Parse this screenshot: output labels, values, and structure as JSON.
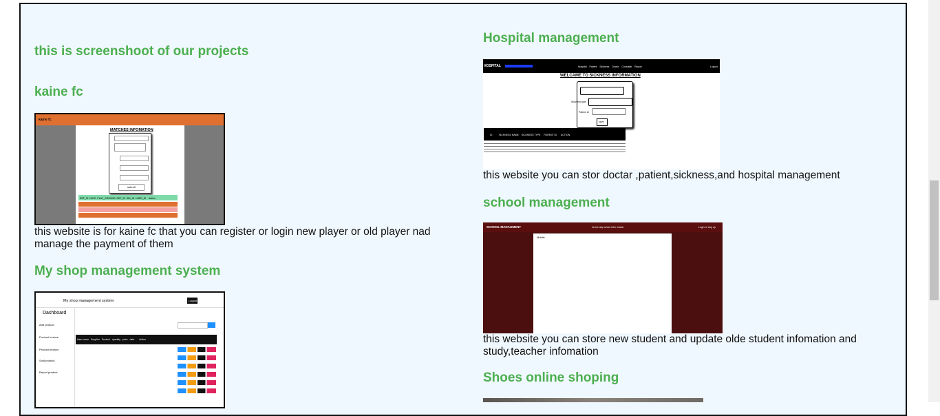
{
  "intro_heading": "this is screenshoot of our projects",
  "projects": {
    "kaine": {
      "title": "kaine fc",
      "description": "this website is for kaine fc that you can register or login new player or old player nad manage the payment of them",
      "shot": {
        "brand": "kaine fc",
        "panel_title": "MATCHES INFOMATION",
        "submit": "submit",
        "columns": [
          "REF_ID",
          "DATE",
          "PLAY_GROUND",
          "REF_ID",
          "AID_ID",
          "USER_ID",
          "Action"
        ]
      }
    },
    "shop": {
      "title": "My shop management system",
      "description": "",
      "shot": {
        "header_title": "My shop management system",
        "logout": "Logout",
        "sidebar_title": "Dashboard",
        "sidebar_items": [
          "Add product",
          "Product in store",
          "Product product",
          "Sold product",
          "Report product"
        ],
        "columns": [
          "User name",
          "Product Supplier",
          "Product name",
          "Product quantity",
          "Total price",
          "Product date",
          "Action"
        ],
        "actions": [
          "Insert",
          "Ord",
          "Edit",
          "Delete"
        ]
      }
    },
    "hospital": {
      "title": "Hospital management",
      "description": "this website you can stor doctar ,patient,sickness,and hospital management",
      "shot": {
        "brand": "HOSPITAL",
        "nav": [
          "Hospital",
          "Patient",
          "Sickness",
          "Doctor",
          "Consultat",
          "Report"
        ],
        "logout": "Logout",
        "page_title": "WELCAME TO SICKNESS INFORMATION",
        "form_labels": [
          "Sickness name",
          "Sickness type",
          "Patient id"
        ],
        "submit": "save",
        "columns": [
          "ID",
          "SICKNESS NAME",
          "SICKNESS TYPE",
          "PATIENT ID",
          "ACTION"
        ]
      }
    },
    "school": {
      "title": "school management",
      "description": "this website you can store new student and update olde student infomation and study,teacher infomation",
      "shot": {
        "brand": "SCHOOL MANAGMENT",
        "subtitle": "hence day school infor mation",
        "login": "Login or sing up",
        "content": "Mobile"
      }
    },
    "shoes": {
      "title": "Shoes online shoping"
    }
  },
  "colors": {
    "heading": "#4caf50",
    "page_bg": "#f0f8ff",
    "kaine_orange": "#e07030",
    "school_maroon": "#4b0f0f"
  }
}
